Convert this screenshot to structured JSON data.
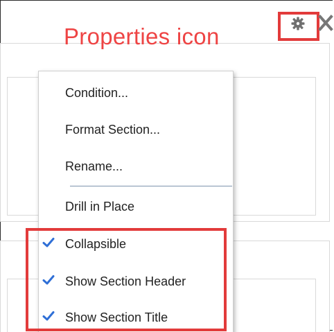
{
  "callout": {
    "text": "Properties icon"
  },
  "toolbar": {
    "gear_icon": "gear-icon",
    "close_icon": "close-icon"
  },
  "menu": {
    "items": [
      {
        "label": "Condition...",
        "checked": false
      },
      {
        "label": "Format Section...",
        "checked": false
      },
      {
        "label": "Rename...",
        "checked": false
      },
      {
        "label": "Drill in Place",
        "checked": false
      },
      {
        "label": "Collapsible",
        "checked": true
      },
      {
        "label": "Show Section Header",
        "checked": true
      },
      {
        "label": "Show Section Title",
        "checked": true
      }
    ]
  },
  "colors": {
    "callout_red": "#ee4444",
    "highlight_red": "#e23b3b",
    "checkmark_blue": "#2f6fd6",
    "separator": "#7d93ad"
  }
}
